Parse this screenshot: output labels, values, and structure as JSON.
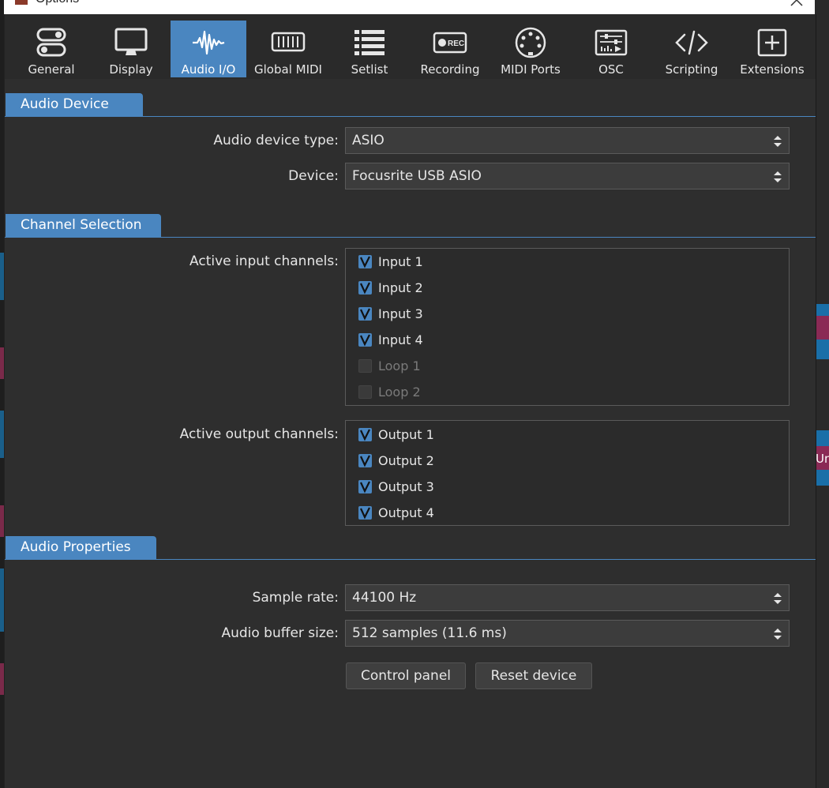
{
  "window": {
    "title": "Options"
  },
  "toolbar": {
    "tabs": [
      {
        "label": "General",
        "icon": "toggle-icon",
        "active": false
      },
      {
        "label": "Display",
        "icon": "monitor-icon",
        "active": false
      },
      {
        "label": "Audio I/O",
        "icon": "waveform-icon",
        "active": true
      },
      {
        "label": "Global MIDI",
        "icon": "keyboard-icon",
        "active": false
      },
      {
        "label": "Setlist",
        "icon": "list-icon",
        "active": false
      },
      {
        "label": "Recording",
        "icon": "rec-icon",
        "active": false
      },
      {
        "label": "MIDI Ports",
        "icon": "midi-connector-icon",
        "active": false
      },
      {
        "label": "OSC",
        "icon": "sliders-icon",
        "active": false
      },
      {
        "label": "Scripting",
        "icon": "code-icon",
        "active": false
      },
      {
        "label": "Extensions",
        "icon": "plus-square-icon",
        "active": false
      }
    ]
  },
  "audio_device": {
    "header": "Audio Device",
    "type_label": "Audio device type:",
    "type_value": "ASIO",
    "device_label": "Device:",
    "device_value": "Focusrite USB ASIO"
  },
  "channels": {
    "header": "Channel Selection",
    "input_label": "Active input channels:",
    "inputs": [
      {
        "label": "Input 1",
        "checked": true,
        "enabled": true
      },
      {
        "label": "Input 2",
        "checked": true,
        "enabled": true
      },
      {
        "label": "Input 3",
        "checked": true,
        "enabled": true
      },
      {
        "label": "Input 4",
        "checked": true,
        "enabled": true
      },
      {
        "label": "Loop 1",
        "checked": false,
        "enabled": false
      },
      {
        "label": "Loop 2",
        "checked": false,
        "enabled": false
      }
    ],
    "output_label": "Active output channels:",
    "outputs": [
      {
        "label": "Output 1",
        "checked": true,
        "enabled": true
      },
      {
        "label": "Output 2",
        "checked": true,
        "enabled": true
      },
      {
        "label": "Output 3",
        "checked": true,
        "enabled": true
      },
      {
        "label": "Output 4",
        "checked": true,
        "enabled": true
      }
    ]
  },
  "properties": {
    "header": "Audio Properties",
    "rate_label": "Sample rate:",
    "rate_value": "44100 Hz",
    "buffer_label": "Audio buffer size:",
    "buffer_value": "512 samples (11.6 ms)",
    "control_panel": "Control panel",
    "reset_device": "Reset device"
  },
  "background": {
    "partial_text": "Un"
  },
  "colors": {
    "accent": "#4a86c0",
    "panel": "#2e2e2e",
    "field": "#3c3c3c"
  }
}
